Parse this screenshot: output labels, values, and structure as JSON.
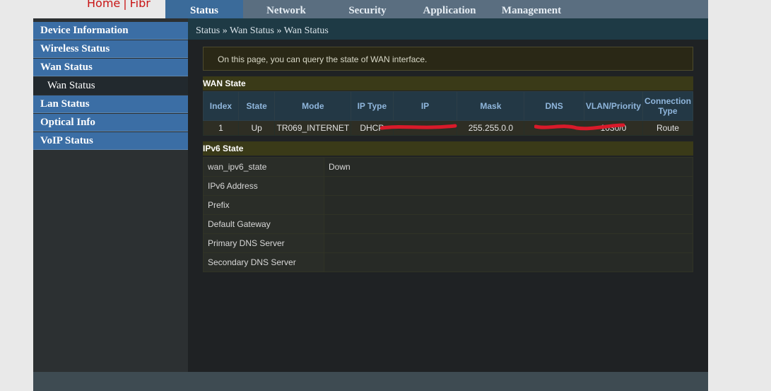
{
  "brand": {
    "name": "Home",
    "separator": "|",
    "product": "Fibr"
  },
  "topnav": {
    "tabs": [
      {
        "label": "Status",
        "active": true
      },
      {
        "label": "Network"
      },
      {
        "label": "Security"
      },
      {
        "label": "Application"
      },
      {
        "label": "Management"
      }
    ]
  },
  "sidebar": {
    "items": [
      {
        "label": "Device Information"
      },
      {
        "label": "Wireless Status"
      },
      {
        "label": "Wan Status"
      },
      {
        "label": "Wan Status",
        "sub": true
      },
      {
        "label": "Lan Status"
      },
      {
        "label": "Optical Info"
      },
      {
        "label": "VoIP Status"
      }
    ]
  },
  "breadcrumb": "Status » Wan Status » Wan Status",
  "notice": "On this page, you can query the state of WAN interface.",
  "wan": {
    "title": "WAN State",
    "headers": [
      "Index",
      "State",
      "Mode",
      "IP Type",
      "IP",
      "Mask",
      "DNS",
      "VLAN/Priority",
      "Connection Type"
    ],
    "row": [
      "1",
      "Up",
      "TR069_INTERNET",
      "DHCP",
      "",
      "255.255.0.0",
      "",
      "1030/0",
      "Route"
    ]
  },
  "ipv6": {
    "title": "IPv6 State",
    "rows": [
      {
        "label": "wan_ipv6_state",
        "value": "Down"
      },
      {
        "label": "IPv6 Address",
        "value": ""
      },
      {
        "label": "Prefix",
        "value": ""
      },
      {
        "label": "Default Gateway",
        "value": ""
      },
      {
        "label": "Primary DNS Server",
        "value": ""
      },
      {
        "label": "Secondary DNS Server",
        "value": ""
      }
    ]
  },
  "colors": {
    "accent": "#3b6ea5",
    "brand": "#c81414",
    "scribble": "#d91a2a"
  }
}
